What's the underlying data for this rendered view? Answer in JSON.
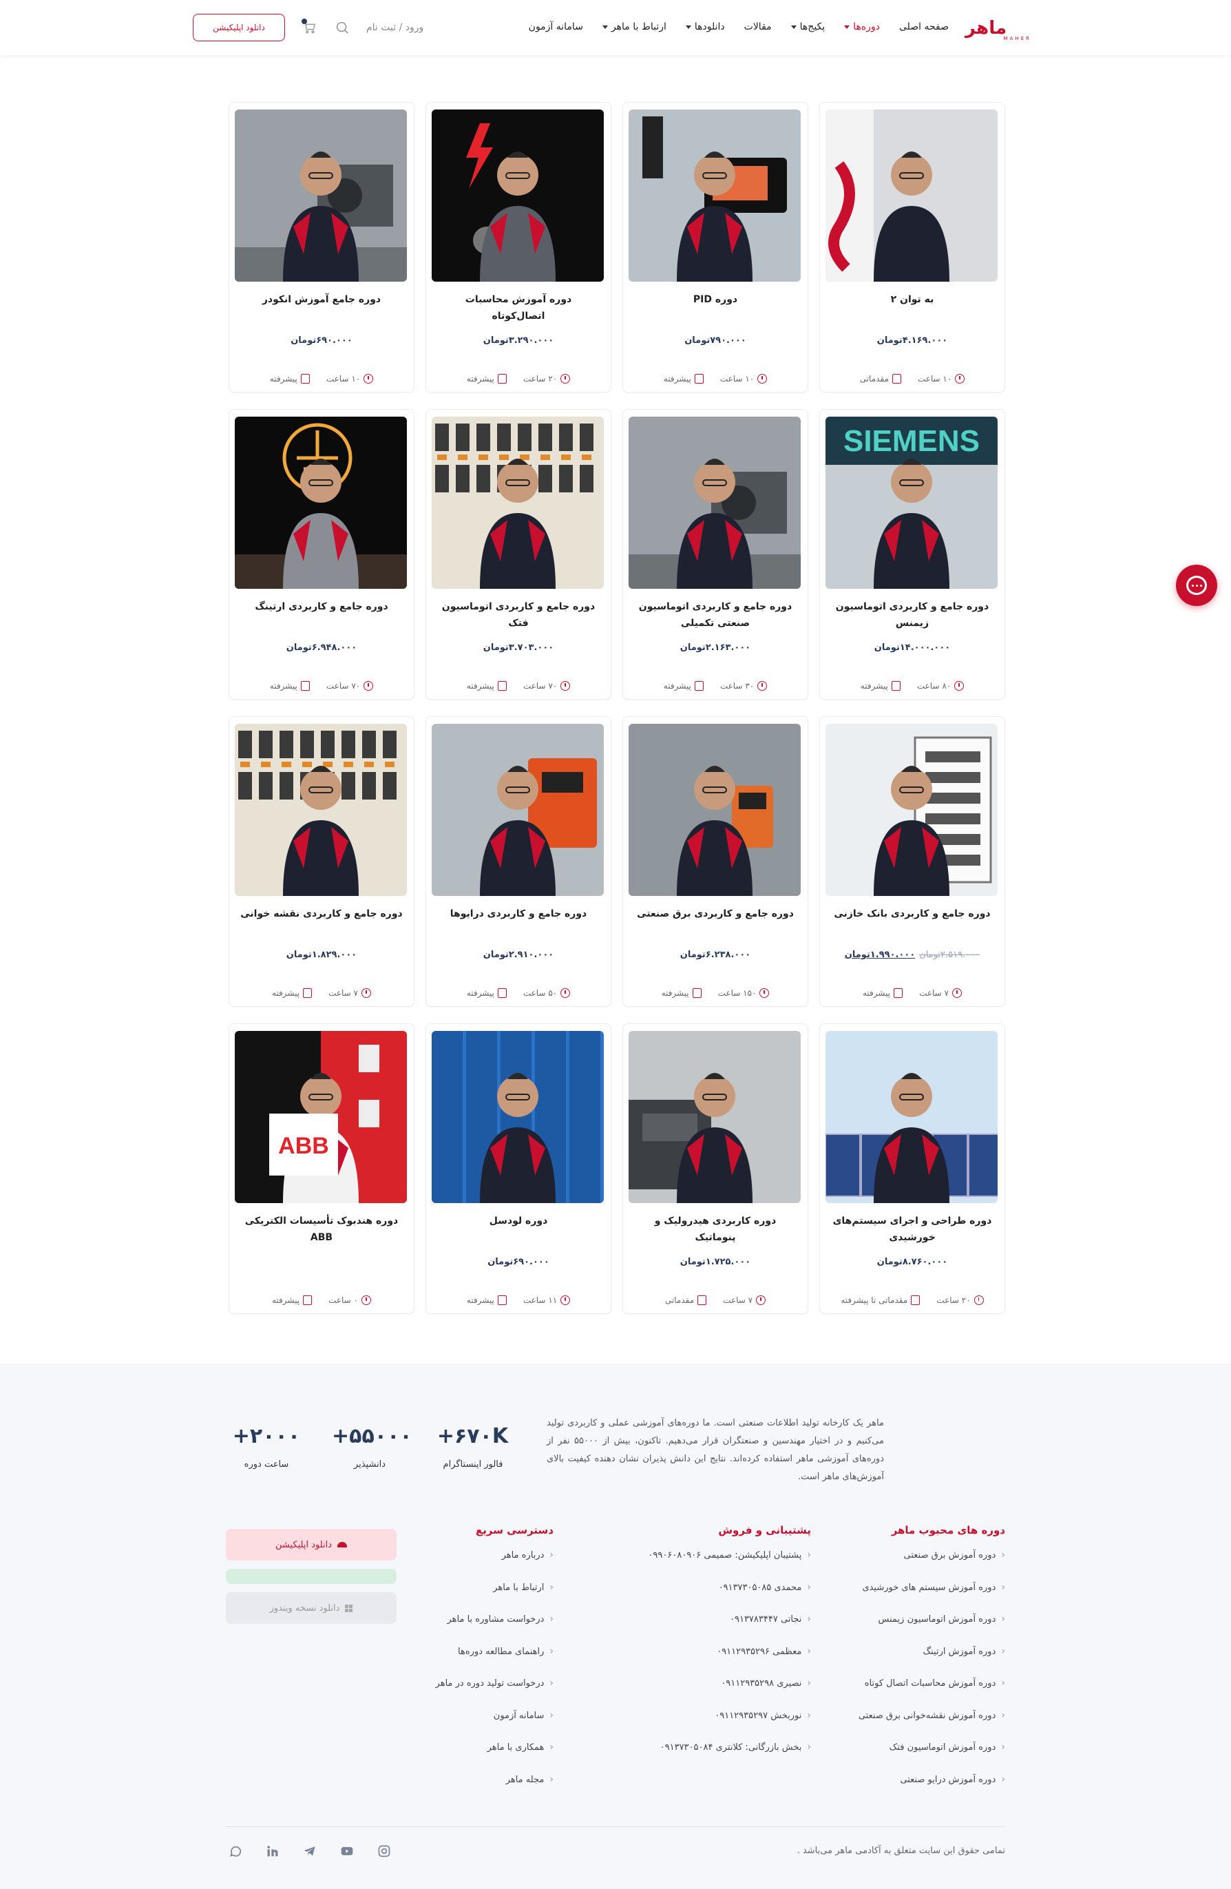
{
  "header": {
    "logo_text": "ماهر",
    "logo_sub": "MAHER",
    "nav": [
      {
        "label": "صفحه اصلی",
        "caret": false,
        "active": false
      },
      {
        "label": "دوره‌ها",
        "caret": true,
        "active": true
      },
      {
        "label": "پکیج‌ها",
        "caret": true,
        "active": false
      },
      {
        "label": "مقالات",
        "caret": false,
        "active": false
      },
      {
        "label": "دانلودها",
        "caret": true,
        "active": false
      },
      {
        "label": "ارتباط با ماهر",
        "caret": true,
        "active": false
      },
      {
        "label": "سامانه آزمون",
        "caret": false,
        "active": false
      }
    ],
    "login_label": "ورود / ثبت نام",
    "app_button": "دانلود اپلیکیشن"
  },
  "courses": [
    {
      "title": "به توان ۲",
      "price": "۴.۱۶۹.۰۰۰تومان",
      "old_price": "",
      "hours": "۱۰ ساعت",
      "level": "مقدماتی",
      "scene": "flag"
    },
    {
      "title": "دوره PID",
      "price": "۷۹۰.۰۰۰تومان",
      "old_price": "",
      "hours": "۱۰ ساعت",
      "level": "پیشرفته",
      "scene": "hmi"
    },
    {
      "title": "دوره آموزش محاسبات اتصال‌کوتاه",
      "price": "۳.۲۹۰.۰۰۰تومان",
      "old_price": "",
      "hours": "۲۰ ساعت",
      "level": "پیشرفته",
      "scene": "bolt"
    },
    {
      "title": "دوره جامع آموزش انکودر",
      "price": "۶۹۰.۰۰۰تومان",
      "old_price": "",
      "hours": "۱۰ ساعت",
      "level": "پیشرفته",
      "scene": "machine"
    },
    {
      "title": "دوره جامع و کاربردی اتوماسیون زیمنس",
      "price": "۱۴.۰۰۰.۰۰۰تومان",
      "old_price": "",
      "hours": "۸۰ ساعت",
      "level": "پیشرفته",
      "scene": "siemens"
    },
    {
      "title": "دوره جامع و کاربردی اتوماسیون صنعتی تکمیلی",
      "price": "۲.۱۶۳.۰۰۰تومان",
      "old_price": "",
      "hours": "۳۰ ساعت",
      "level": "پیشرفته",
      "scene": "machine"
    },
    {
      "title": "دوره جامع و کاربردی اتوماسیون فتک",
      "price": "۳.۷۰۳.۰۰۰تومان",
      "old_price": "",
      "hours": "۷۰ ساعت",
      "level": "پیشرفته",
      "scene": "panel"
    },
    {
      "title": "دوره جامع و کاربردی ارتینگ",
      "price": "۶.۹۴۸.۰۰۰تومان",
      "old_price": "",
      "hours": "۷۰ ساعت",
      "level": "پیشرفته",
      "scene": "ground"
    },
    {
      "title": "دوره جامع و کاربردی بانک خازنی",
      "price": "۱.۹۹۰.۰۰۰تومان",
      "old_price": "۲.۵۱۹.۰۰۰تومان",
      "hours": "۷ ساعت",
      "level": "پیشرفته",
      "scene": "cabinet"
    },
    {
      "title": "دوره جامع و کاربردی برق صنعتی",
      "price": "۶.۲۳۸.۰۰۰تومان",
      "old_price": "",
      "hours": "۱۵۰ ساعت",
      "level": "پیشرفته",
      "scene": "meter"
    },
    {
      "title": "دوره جامع و کاربردی درایوها",
      "price": "۲.۹۱۰.۰۰۰تومان",
      "old_price": "",
      "hours": "۵۰ ساعت",
      "level": "پیشرفته",
      "scene": "drive"
    },
    {
      "title": "دوره جامع و کاربردی نقشه خوانی",
      "price": "۱.۸۲۹.۰۰۰تومان",
      "old_price": "",
      "hours": "۷ ساعت",
      "level": "پیشرفته",
      "scene": "panel"
    },
    {
      "title": "دوره طراحی و اجرای سیستم‌های خورشیدی",
      "price": "۸.۷۶۰.۰۰۰تومان",
      "old_price": "",
      "hours": "۲۰ ساعت",
      "level": "مقدماتی تا پیشرفته",
      "scene": "solar"
    },
    {
      "title": "دوره کاربردی هیدرولیک و پنوماتیک",
      "price": "۱.۷۲۵.۰۰۰تومان",
      "old_price": "",
      "hours": "۷ ساعت",
      "level": "مقدماتی",
      "scene": "hydraulic"
    },
    {
      "title": "دوره لودسل",
      "price": "۶۹۰.۰۰۰تومان",
      "old_price": "",
      "hours": "۱۱ ساعت",
      "level": "پیشرفته",
      "scene": "blue"
    },
    {
      "title": "دوره هندبوک تأسیسات الکتریکی ABB",
      "price": "",
      "old_price": "",
      "hours": "۰ ساعت",
      "level": "پیشرفته",
      "scene": "abb"
    }
  ],
  "footer": {
    "about": "ماهر یک کارخانه تولید اطلاعات صنعتی است. ما دوره‌های آموزشی عملی و کاربردی تولید می‌کنیم و در اختیار مهندسین و صنعتگران قرار می‌دهیم. تاکنون، بیش از ۵۵۰۰۰ نفر از دوره‌های آموزشی ماهر استفاده کرده‌اند. نتایج این دانش پذیران نشان دهنده کیفیت بالای آموزش‌های ماهر است.",
    "stats": [
      {
        "num": "+۶۷۰K",
        "label": "فالور اینستاگرام"
      },
      {
        "num": "+۵۵۰۰۰",
        "label": "دانشپذیر"
      },
      {
        "num": "+۲۰۰۰",
        "label": "ساعت دوره"
      }
    ],
    "popular_title": "دوره های محبوب ماهر",
    "popular": [
      "دوره آموزش برق صنعتی",
      "دوره آموزش سیستم های خورشیدی",
      "دوره آموزش اتوماسیون زیمنس",
      "دوره آموزش ارتینگ",
      "دوره آموزش محاسبات اتصال کوتاه",
      "دوره آموزش نقشه‌خوانی برق صنعتی",
      "دوره آموزش اتوماسیون فتک",
      "دوره آموزش درایو صنعتی"
    ],
    "support_title": "پشتیبانی و فروش",
    "support": [
      "پشتیبان اپلیکیشن: صمیمی ۰۹۹۰۶۰۸۰۹۰۶",
      "محمدی ۰۹۱۳۷۳۰۵۰۸۵",
      "نجاتی ۰۹۱۳۷۸۳۴۴۷",
      "معظمی ۰۹۱۱۲۹۳۵۲۹۶",
      "نصیری ۰۹۱۱۲۹۳۵۲۹۸",
      "نوربخش ۰۹۱۱۲۹۳۵۲۹۷",
      "بخش بازرگانی: کلانتری ۰۹۱۳۷۳۰۵۰۸۴"
    ],
    "quick_title": "دسترسی سریع",
    "quick": [
      "درباره ماهر",
      "ارتباط با ماهر",
      "درخواست مشاوره با ماهر",
      "راهنمای مطالعه دوره‌ها",
      "درخواست تولید دوره در ماهر",
      "سامانه آزمون",
      "همکاری با ماهر",
      "مجله ماهر"
    ],
    "app_download": "دانلود اپلیکیشن",
    "windows_download": "دانلود نسخه ویندوز",
    "copyright": "تمامی حقوق این سایت متعلق به آکادمی ماهر می‌باشد .",
    "social": [
      "instagram-icon",
      "youtube-icon",
      "telegram-icon",
      "linkedin-icon",
      "whatsapp-icon"
    ]
  },
  "colors": {
    "brand": "#c8102e",
    "navy": "#2b3b5c"
  }
}
